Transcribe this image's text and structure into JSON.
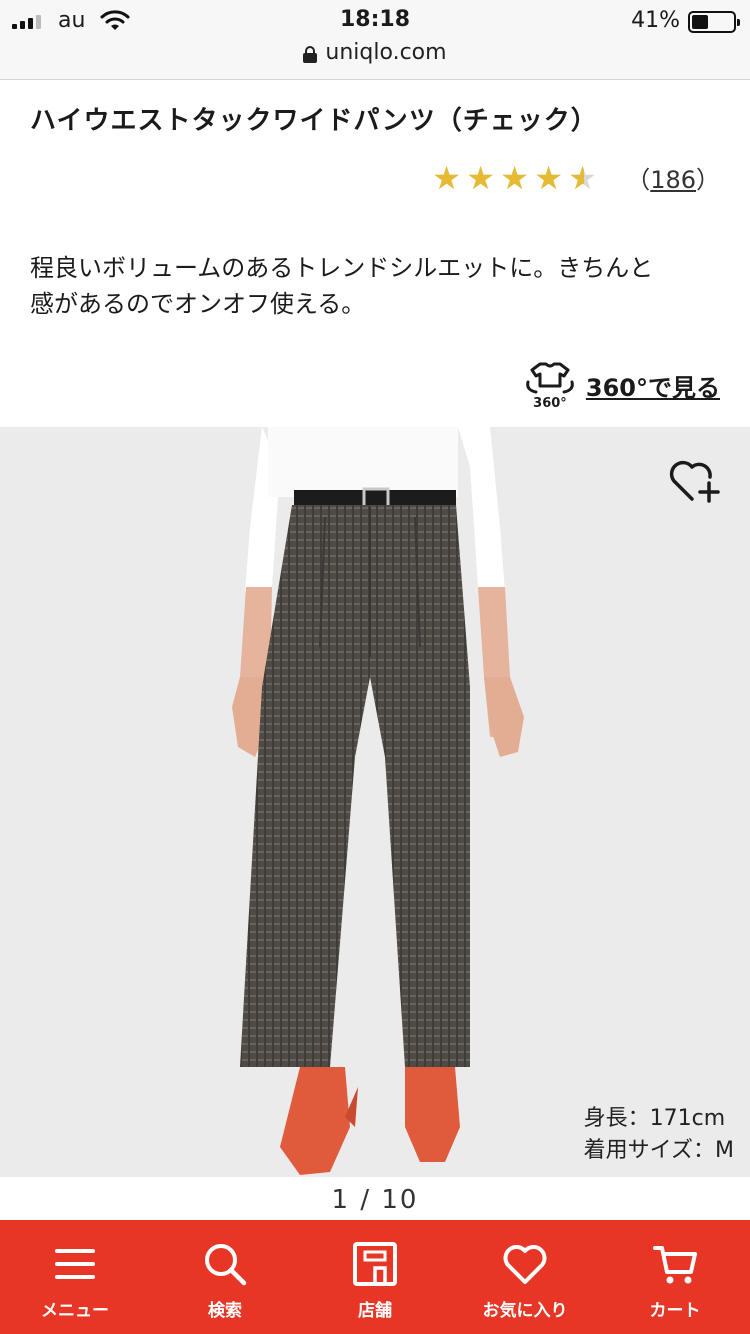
{
  "status_bar": {
    "carrier": "au",
    "time": "18:18",
    "battery_percent_label": "41%",
    "battery_level": 0.41,
    "url": "uniqlo.com"
  },
  "product": {
    "title": "ハイウエストタックワイドパンツ（チェック）",
    "rating": 4.5,
    "review_count_open": "（",
    "review_count": "186",
    "review_count_close": "）",
    "description_line1": "程良いボリュームのあるトレンドシルエットに。きちんと",
    "description_line2": "感があるのでオンオフ使える。",
    "view360_label": "360°で見る",
    "view360_icon_text": "360°"
  },
  "image": {
    "model_height": "身長：171cm",
    "model_size": "着用サイズ：M",
    "pager": "1 / 10"
  },
  "nav": {
    "items": [
      {
        "label": "メニュー",
        "icon": "menu-icon"
      },
      {
        "label": "検索",
        "icon": "search-icon"
      },
      {
        "label": "店舗",
        "icon": "store-icon"
      },
      {
        "label": "お気に入り",
        "icon": "heart-icon"
      },
      {
        "label": "カート",
        "icon": "cart-icon"
      }
    ]
  },
  "colors": {
    "accent_red": "#e73626",
    "star_gold": "#e4bb33",
    "image_bg": "#ebebeb"
  }
}
